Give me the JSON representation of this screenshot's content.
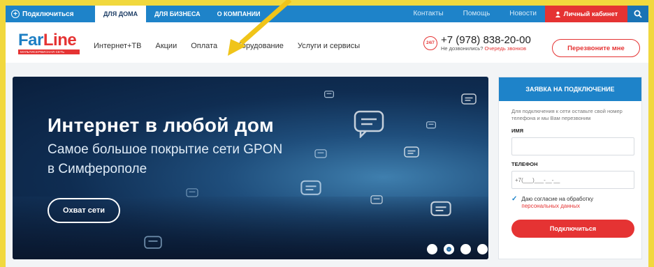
{
  "topbar": {
    "connect_label": "Подключиться",
    "tabs": [
      "Для дома",
      "Для бизнеса",
      "О компании"
    ],
    "links": [
      "Контакты",
      "Помощь",
      "Новости"
    ],
    "cabinet_label": "Личный кабинет"
  },
  "header": {
    "logo": {
      "part1": "Far",
      "part2": "Line",
      "tagline": "МУЛЬТИСЕРВИСНАЯ СЕТЬ"
    },
    "nav": [
      "Интернет+ТВ",
      "Акции",
      "Оплата",
      "Оборудование",
      "Услуги и сервисы"
    ],
    "phone": {
      "badge": "24/7",
      "number": "+7 (978) 838-20-00",
      "note": "Не дозвонились?",
      "note_link": "Очередь звонков"
    },
    "callback_label": "Перезвоните мне"
  },
  "hero": {
    "title": "Интернет в любой дом",
    "subtitle_line1": "Самое большое покрытие сети GPON",
    "subtitle_line2": "в Симферополе",
    "coverage_button": "Охват сети",
    "slides_total": 4,
    "active_slide": 2
  },
  "form": {
    "title": "ЗАЯВКА НА ПОДКЛЮЧЕНИЕ",
    "description": "Для подключения к сети оставьте свой номер телефона и мы Вам перезвоним",
    "name_label": "ИМЯ",
    "phone_label": "ТЕЛЕФОН",
    "phone_placeholder": "+7(___)___-__-__",
    "consent_text": "Даю согласие на обработку",
    "consent_link": "персональных данных",
    "submit_label": "Подключиться"
  },
  "colors": {
    "brand_blue": "#1e83c9",
    "brand_red": "#e53333",
    "annotation_yellow": "#f1d83e"
  }
}
